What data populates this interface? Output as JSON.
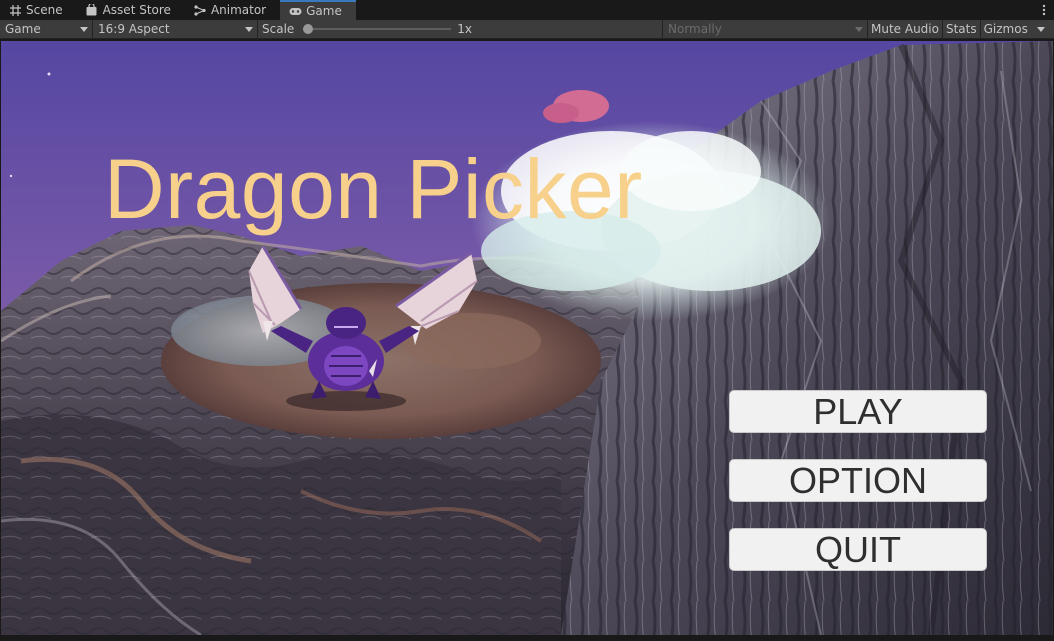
{
  "tabs": [
    {
      "label": "Scene",
      "icon": "grid-icon"
    },
    {
      "label": "Asset Store",
      "icon": "bag-icon"
    },
    {
      "label": "Animator",
      "icon": "animator-icon"
    },
    {
      "label": "Game",
      "icon": "gamepad-icon",
      "active": true
    }
  ],
  "toolbar": {
    "display": "Game",
    "aspect": "16:9 Aspect",
    "scale_label": "Scale",
    "scale_value": "1x",
    "vsync": "Normally",
    "mute_audio": "Mute Audio",
    "stats": "Stats",
    "gizmos": "Gizmos"
  },
  "game": {
    "title": "Dragon Picker",
    "buttons": {
      "play": "PLAY",
      "option": "OPTION",
      "quit": "QUIT"
    }
  },
  "colors": {
    "title": "#f7d18b",
    "tab_accent": "#3a79bb",
    "sky_top": "#5b4ea8",
    "sky_bottom": "#c27aa6",
    "button_bg": "#f1f1f1"
  }
}
